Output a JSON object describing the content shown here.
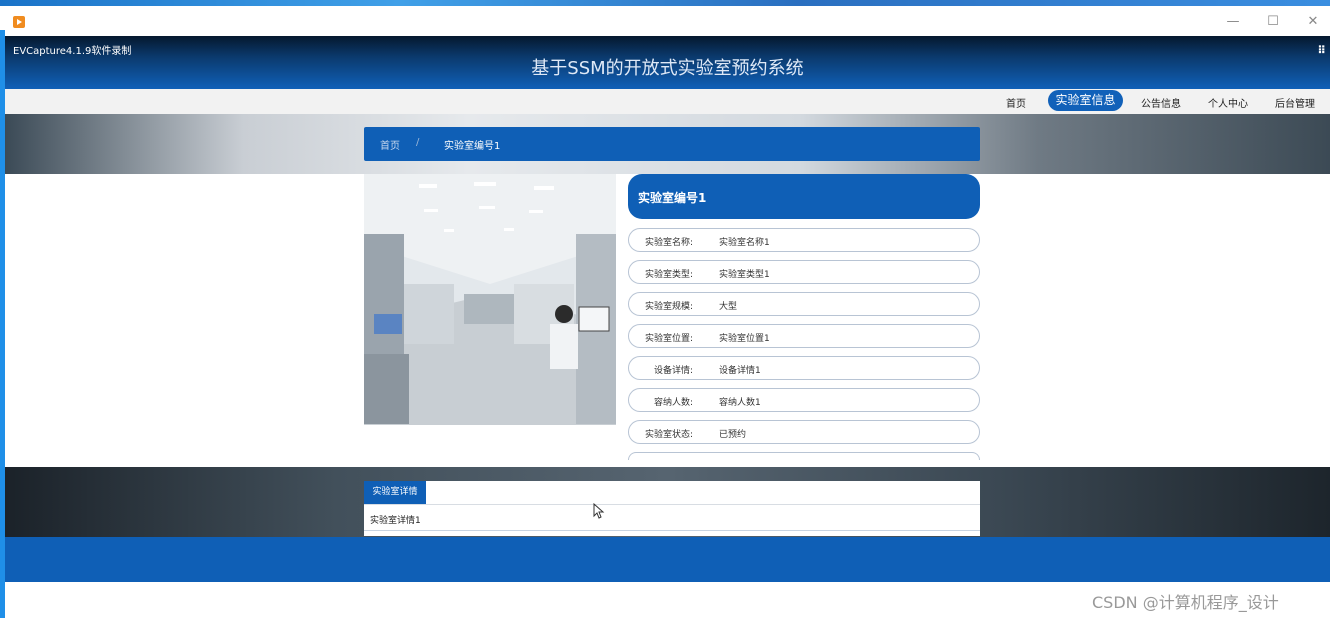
{
  "window": {
    "minimize": "—",
    "maximize": "☐",
    "close": "✕"
  },
  "recorder": {
    "label": "EVCapture4.1.9软件录制"
  },
  "header": {
    "title": "基于SSM的开放式实验室预约系统",
    "grid_glyph": "⠿"
  },
  "nav": {
    "items": [
      "首页",
      "实验室信息",
      "公告信息",
      "个人中心",
      "后台管理"
    ],
    "active": "实验室信息"
  },
  "breadcrumb": {
    "home": "首页",
    "separator": "/",
    "current": "实验室编号1"
  },
  "lab": {
    "heading": "实验室编号1",
    "fields": [
      {
        "label": "实验室名称:",
        "value": "实验室名称1"
      },
      {
        "label": "实验室类型:",
        "value": "实验室类型1"
      },
      {
        "label": "实验室规模:",
        "value": "大型"
      },
      {
        "label": "实验室位置:",
        "value": "实验室位置1"
      },
      {
        "label": "设备详情:",
        "value": "设备详情1"
      },
      {
        "label": "容纳人数:",
        "value": "容纳人数1"
      },
      {
        "label": "实验室状态:",
        "value": "已预约"
      }
    ]
  },
  "detail": {
    "tab_label": "实验室详情",
    "content": "实验室详情1"
  },
  "watermark": "CSDN @计算机程序_设计",
  "colors": {
    "primary": "#0f5fb6",
    "nav_bg": "#f2f2f2"
  }
}
